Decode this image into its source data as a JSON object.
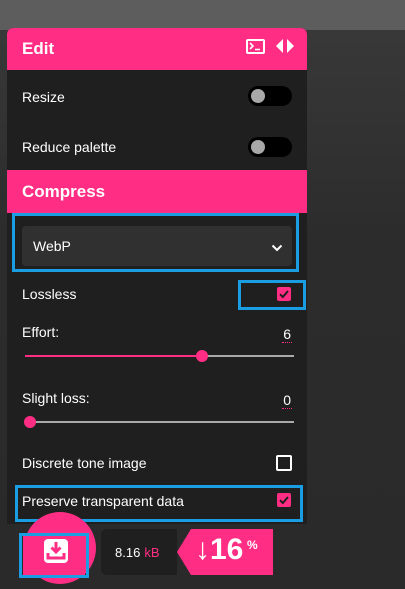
{
  "edit": {
    "title": "Edit",
    "resize_label": "Resize",
    "reduce_palette_label": "Reduce palette"
  },
  "compress": {
    "title": "Compress",
    "format_value": "WebP",
    "lossless_label": "Lossless",
    "lossless_checked": true,
    "effort_label": "Effort:",
    "effort_value": "6",
    "slight_loss_label": "Slight loss:",
    "slight_loss_value": "0",
    "discrete_tone_label": "Discrete tone image",
    "discrete_tone_checked": false,
    "preserve_transparent_label": "Preserve transparent data",
    "preserve_transparent_checked": true
  },
  "result": {
    "size_value": "8.16",
    "size_unit": "kB",
    "reduction_value": "↓16",
    "reduction_unit": "%"
  },
  "colors": {
    "accent": "#ff2e84",
    "panel": "#1f1f1f",
    "highlight": "#1a9de3"
  },
  "icons": [
    "terminal-icon",
    "swap-arrows-icon",
    "chevron-down-icon",
    "checkmark-icon",
    "download-icon"
  ]
}
